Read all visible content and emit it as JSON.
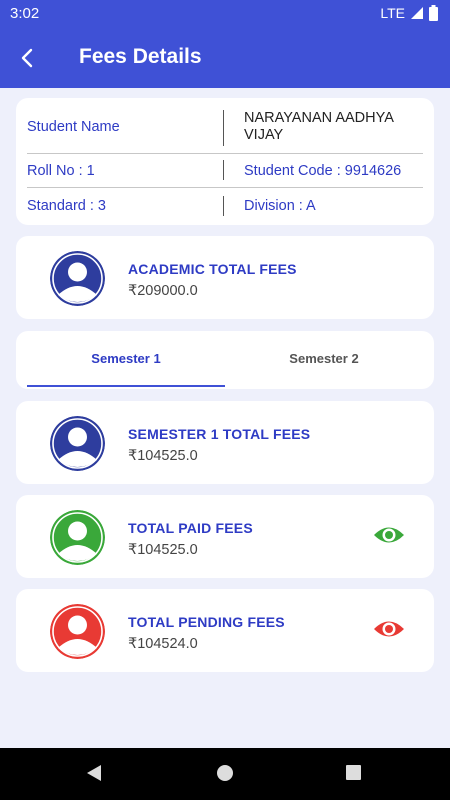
{
  "status": {
    "time": "3:02",
    "network": "LTE"
  },
  "header": {
    "title": "Fees Details"
  },
  "student": {
    "name_label": "Student Name",
    "name_value": "NARAYANAN AADHYA VIJAY",
    "roll": "Roll No : 1",
    "code": "Student Code : 9914626",
    "standard": "Standard : 3",
    "division": "Division : A"
  },
  "academic": {
    "title": "ACADEMIC TOTAL FEES",
    "amount": "₹209000.0",
    "avatar_color": "#2e3d9e"
  },
  "tabs": [
    {
      "label": "Semester 1",
      "selected": true
    },
    {
      "label": "Semester 2",
      "selected": false
    }
  ],
  "fees": [
    {
      "title": "SEMESTER 1 TOTAL FEES",
      "amount": "₹104525.0",
      "avatar_color": "#2e3d9e",
      "icon": "avatar-icon"
    },
    {
      "title": "TOTAL PAID FEES",
      "amount": "₹104525.0",
      "avatar_color": "#3aa83a",
      "icon": "eye-icon"
    },
    {
      "title": "TOTAL PENDING FEES",
      "amount": "₹104524.0",
      "avatar_color": "#e83a34",
      "icon": "eye-icon"
    }
  ],
  "colors": {
    "primary": "#3f51d6",
    "accent_text": "#2e3bc4",
    "paid": "#3aa83a",
    "pending": "#e83a34"
  }
}
